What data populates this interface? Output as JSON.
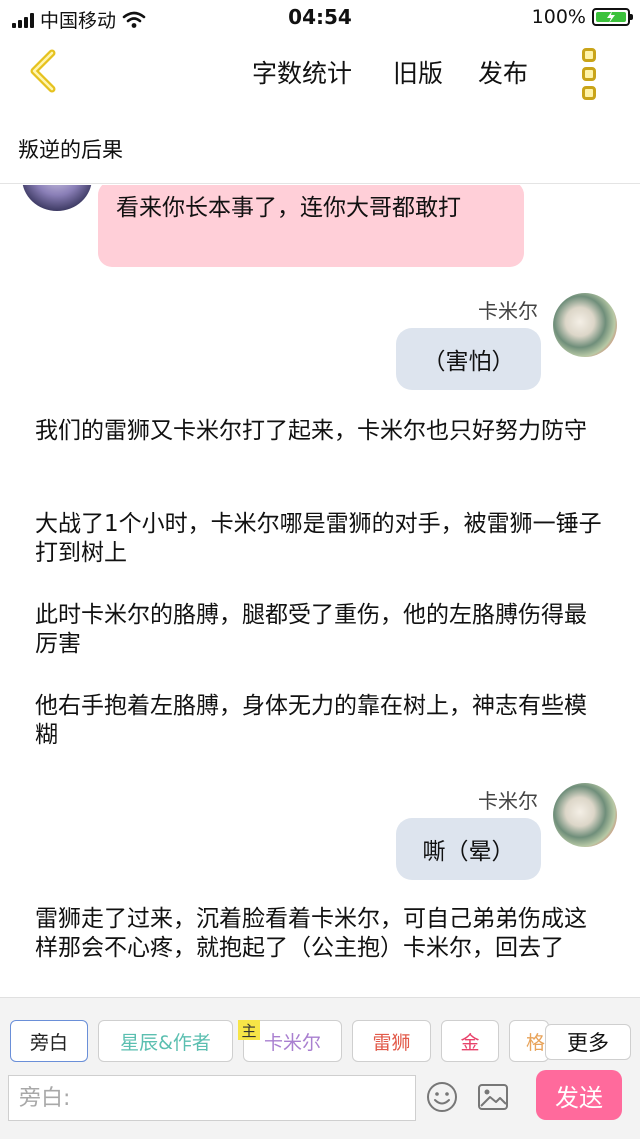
{
  "status_bar": {
    "carrier": "中国移动",
    "time": "04:54",
    "battery": "100%"
  },
  "nav": {
    "word_count": "字数统计",
    "old_version": "旧版",
    "publish": "发布"
  },
  "story_title": "叛逆的后果",
  "messages": [
    {
      "text": "看来你长本事了，连你大哥都敢打"
    },
    {
      "speaker": "卡米尔",
      "text": "（害怕）"
    },
    {
      "text": "我们的雷狮又卡米尔打了起来，卡米尔也只好努力防守"
    },
    {
      "text": "大战了1个小时，卡米尔哪是雷狮的对手，被雷狮一锤子打到树上"
    },
    {
      "text": "此时卡米尔的胳膊，腿都受了重伤，他的左胳膊伤得最厉害"
    },
    {
      "text": "他右手抱着左胳膊，身体无力的靠在树上，神志有些模糊"
    },
    {
      "speaker": "卡米尔",
      "text": "嘶（晕）"
    },
    {
      "text": "雷狮走了过来，沉着脸看着卡米尔，可自己弟弟伤成这样那会不心疼，就抱起了（公主抱）卡米尔，回去了"
    }
  ],
  "roles": [
    {
      "label": "旁白",
      "color": "#222222"
    },
    {
      "label": "星辰&作者",
      "color": "#5bbfb0"
    },
    {
      "label": "卡米尔",
      "color": "#a97fd0",
      "badge": "主"
    },
    {
      "label": "雷狮",
      "color": "#e25a4a"
    },
    {
      "label": "金",
      "color": "#e8436b"
    },
    {
      "label": "格",
      "color": "#e8a35a"
    }
  ],
  "more_roles": "更多",
  "input_placeholder": "旁白:",
  "send": "发送",
  "colors": {
    "accent": "#ff6a9c",
    "pink_bubble": "#ffcfd8",
    "grey_bubble": "#dde4ee",
    "back_arrow": "#e6c21f"
  }
}
